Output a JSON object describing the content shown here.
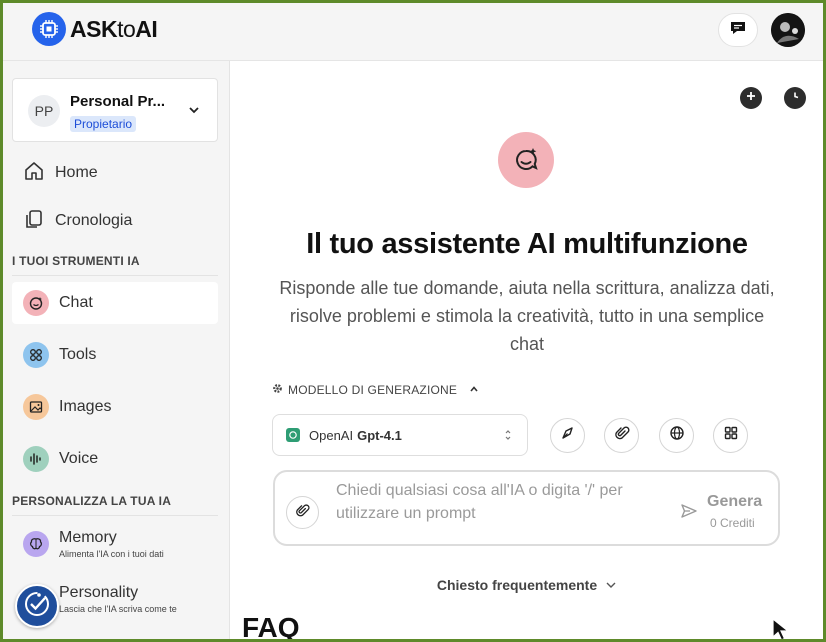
{
  "header": {
    "logo_ask": "ASK",
    "logo_to": "to",
    "logo_ai": "AI",
    "brand_color": "#2563eb"
  },
  "sidebar": {
    "workspace": {
      "initials": "PP",
      "name": "Personal Pr...",
      "role": "Propietario"
    },
    "nav": [
      {
        "label": "Home",
        "icon": "home-icon"
      },
      {
        "label": "Cronologia",
        "icon": "history-pages-icon"
      }
    ],
    "tools_section": "I TUOI STRUMENTI IA",
    "tools": [
      {
        "label": "Chat",
        "icon": "chat-smile-icon",
        "color": "#f3b2b8"
      },
      {
        "label": "Tools",
        "icon": "tools-grid-icon",
        "color": "#8ec4ee"
      },
      {
        "label": "Images",
        "icon": "image-icon",
        "color": "#f6c79a"
      },
      {
        "label": "Voice",
        "icon": "voice-wave-icon",
        "color": "#9fd0bd"
      }
    ],
    "personalize_section": "PERSONALIZZA LA TUA IA",
    "personalize": [
      {
        "title": "Memory",
        "subtitle": "Alimenta l'IA con i tuoi dati",
        "icon": "brain-icon",
        "color": "#b9a6ef"
      },
      {
        "title": "Personality",
        "subtitle": "Lascia che l'IA scriva come te",
        "icon": "personality-icon"
      }
    ]
  },
  "main": {
    "title": "Il tuo assistente AI multifunzione",
    "subtitle": "Risponde alle tue domande, aiuta nella scrittura, analizza dati, risolve problemi e stimola la creatività, tutto in una semplice chat",
    "model_section_label": "MODELLO DI GENERAZIONE",
    "model": {
      "provider": "OpenAI",
      "name": "Gpt-4.1"
    },
    "prompt": {
      "placeholder": "Chiedi qualsiasi cosa all'IA o digita '/' per utilizzare un prompt",
      "generate_label": "Genera",
      "credits": "0 Crediti"
    },
    "faq_toggle": "Chiesto frequentemente",
    "faq_heading": "FAQ"
  }
}
